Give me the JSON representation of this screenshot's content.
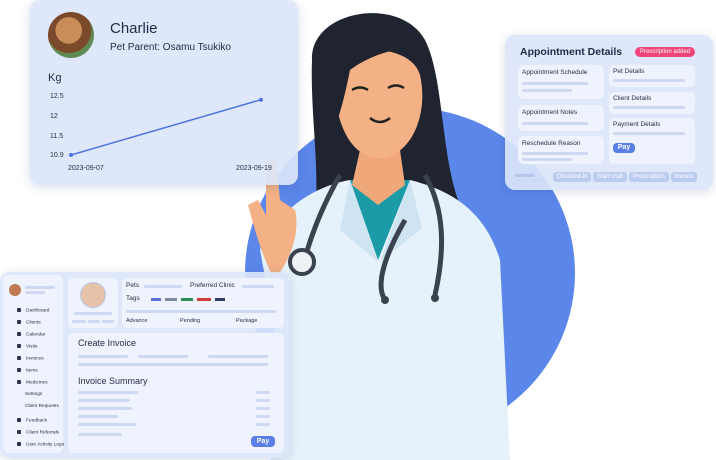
{
  "pet_card": {
    "name": "Charlie",
    "parent_label": "Pet Parent: Osamu Tsukiko",
    "chart_title": "Kg"
  },
  "chart_data": {
    "type": "line",
    "title": "Kg",
    "x": [
      "2023-09-07",
      "2023-09-19"
    ],
    "series": [
      {
        "values": [
          10.9,
          12.4
        ]
      }
    ],
    "yticks": [
      "12.5",
      "12",
      "11.5",
      "10.9"
    ],
    "xticks": [
      "2023-09-07",
      "2023-09-19"
    ],
    "ylim": [
      10.9,
      12.5
    ],
    "color": "#4f74e0"
  },
  "appointment": {
    "title": "Appointment Details",
    "badge": "Prescription added",
    "left_sections": [
      "Appointment Schedule",
      "Appointment Notes",
      "Reschedule Reason"
    ],
    "right_sections": [
      "Pet Details",
      "Client Details",
      "Payment Details"
    ],
    "pay_label": "Pay",
    "tabs": [
      "Checked-In",
      "Start Visit",
      "Prescription",
      "Invoice"
    ]
  },
  "dashboard": {
    "nav": [
      "Dashboard",
      "Clients",
      "Calendar",
      "Visits",
      "Invoices",
      "Items",
      "Medicines",
      "Settings",
      "Client Requests",
      "Feedback",
      "Client Referrals",
      "User Activity Logs"
    ],
    "pets_label": "Pets",
    "preferred_clinic_label": "Preferred Clinic",
    "tags_label": "Tags",
    "tag_colors": [
      "#5b6fd6",
      "#7e8aa0",
      "#2f8a55",
      "#d13b3b",
      "#2f3a66"
    ],
    "advance_label": "Advance",
    "pending_label": "Pending",
    "package_label": "Package",
    "create_invoice": "Create Invoice",
    "invoice_summary": "Invoice Summary",
    "pay_label": "Pay"
  },
  "colors": {
    "accent": "#5b7fe6",
    "badge": "#f0447a",
    "circle": "#5b86ea"
  }
}
